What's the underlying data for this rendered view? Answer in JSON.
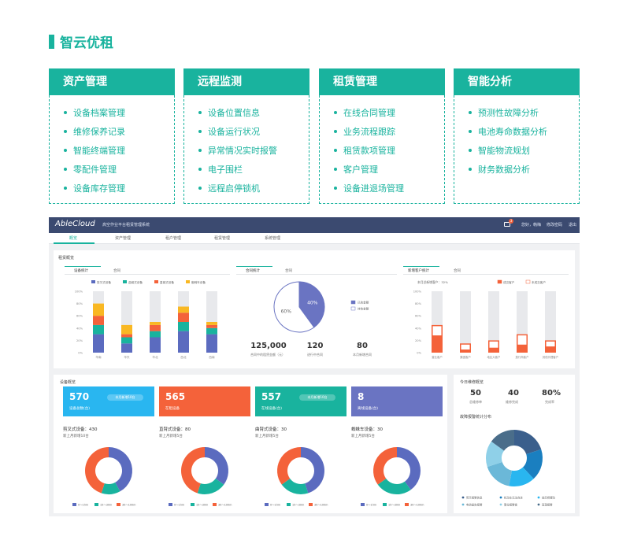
{
  "page_title": "智云优租",
  "cards": [
    {
      "title": "资产管理",
      "items": [
        "设备档案管理",
        "维修保养记录",
        "智能终端管理",
        "零配件管理",
        "设备库存管理"
      ]
    },
    {
      "title": "远程监测",
      "items": [
        "设备位置信息",
        "设备运行状况",
        "异常情况实时报警",
        "电子围栏",
        "远程启停锁机"
      ]
    },
    {
      "title": "租赁管理",
      "items": [
        "在线合同管理",
        "业务流程跟踪",
        "租赁款项管理",
        "客户管理",
        "设备进退场管理"
      ]
    },
    {
      "title": "智能分析",
      "items": [
        "预测性故障分析",
        "电池寿命数据分析",
        "智能物流规划",
        "财务数据分析"
      ]
    }
  ],
  "app": {
    "logo": "AbleCloud",
    "system_name": "高空作业平台租赁管理系统",
    "topbar_right": [
      "您好，韩梅",
      "修改密码",
      "退出"
    ],
    "msg_badge": "3",
    "nav": [
      "概览",
      "资产管理",
      "租户管理",
      "租赁管理",
      "系统管理"
    ],
    "lease_overview": {
      "title": "租赁概览",
      "device_stats": {
        "tabs": [
          "设备统计",
          "合同"
        ],
        "legend": [
          "剪叉式设备",
          "曲臂式设备",
          "直臂式设备",
          "蜘蛛车设备"
        ],
        "legend_colors": [
          "#5b6bbf",
          "#19b39e",
          "#f4623a",
          "#f9b823"
        ]
      },
      "contract_stats": {
        "tabs": [
          "合同统计",
          "合同"
        ],
        "legend": [
          "已收金额",
          "待收金额"
        ],
        "stats": [
          {
            "value": "125,000",
            "label": "合同中的租赁金额（元）"
          },
          {
            "value": "120",
            "label": "进行中合同"
          },
          {
            "value": "80",
            "label": "本月新增合同"
          }
        ]
      },
      "customer_stats": {
        "tabs": [
          "新增客户统计",
          "合同"
        ],
        "header": "本月总新增客户：32%",
        "legend": [
          "成交客户",
          "未成交客户"
        ]
      }
    },
    "device_overview": {
      "title": "设备概览",
      "boxes": [
        {
          "value": "570",
          "label": "设备总数(台)",
          "pill": "本月新增10台",
          "color": "#29b6f0"
        },
        {
          "value": "565",
          "label": "在租设备",
          "pill": "",
          "color": "#f4623a"
        },
        {
          "value": "557",
          "label": "在线设备(台)",
          "pill": "本月新增10台",
          "color": "#19b39e"
        },
        {
          "value": "8",
          "label": "离线设备(台)",
          "pill": "",
          "color": "#6a74c2"
        }
      ],
      "types": [
        {
          "title": "剪叉式设备：430",
          "sub": "新上月新增10台"
        },
        {
          "title": "直臂式设备：80",
          "sub": "新上月新增5台"
        },
        {
          "title": "曲臂式设备：30",
          "sub": "新上月新增5台"
        },
        {
          "title": "蜘蛛车设备：30",
          "sub": "新上月新增5台"
        }
      ],
      "donut_legend": [
        "0～15m",
        "15～30m",
        "30～100m"
      ],
      "donut_colors": [
        "#5b6bbf",
        "#19b39e",
        "#f4623a"
      ]
    },
    "today_repair": {
      "title": "今日维修概览",
      "stats": [
        {
          "value": "50",
          "label": "总维修单"
        },
        {
          "value": "40",
          "label": "维修完成"
        },
        {
          "value": "80%",
          "label": "完成率"
        }
      ],
      "fault_title": "故障报警统计分布",
      "fault_legend": [
        "剪叉报警信息",
        "机动车无法自走",
        "前后桥摆动",
        "电池量告报警",
        "限位报警锁",
        "高温报警"
      ]
    }
  },
  "chart_data": [
    {
      "type": "bar",
      "title": "设备统计",
      "categories": [
        "华南",
        "华东",
        "华北",
        "西北",
        "西南"
      ],
      "series": [
        {
          "name": "剪叉式设备",
          "values": [
            30,
            15,
            25,
            35,
            30
          ]
        },
        {
          "name": "曲臂式设备",
          "values": [
            15,
            10,
            10,
            15,
            10
          ]
        },
        {
          "name": "直臂式设备",
          "values": [
            15,
            5,
            10,
            15,
            5
          ]
        },
        {
          "name": "蜘蛛车设备",
          "values": [
            20,
            15,
            5,
            10,
            5
          ]
        }
      ],
      "ylim": [
        0,
        100
      ],
      "yticks": [
        "0%",
        "20%",
        "40%",
        "60%",
        "80%",
        "100%"
      ]
    },
    {
      "type": "pie",
      "title": "合同统计",
      "labels": [
        "已收金额",
        "待收金额"
      ],
      "values": [
        40,
        60
      ],
      "value_labels": [
        "40%",
        "60%"
      ],
      "colors": [
        "#6a74c2",
        "#ffffff"
      ]
    },
    {
      "type": "bar",
      "title": "新增客户统计",
      "categories": [
        "营业客户",
        "集团客户",
        "地区大客户",
        "旅行商客户",
        "其他代理客户"
      ],
      "series": [
        {
          "name": "成交客户",
          "values": [
            45,
            15,
            20,
            30,
            20
          ]
        },
        {
          "name": "未成交客户",
          "values": [
            15,
            8,
            10,
            15,
            8
          ]
        }
      ],
      "ylim": [
        0,
        100
      ],
      "yticks": [
        "0%",
        "20%",
        "40%",
        "60%",
        "80%",
        "100%"
      ]
    },
    {
      "type": "pie",
      "title": "剪叉式设备：430",
      "labels": [
        "0～15m",
        "15～30m",
        "30～100m"
      ],
      "values": [
        42,
        13,
        45
      ]
    },
    {
      "type": "pie",
      "title": "直臂式设备：80",
      "labels": [
        "0～15m",
        "15～30m",
        "30～100m"
      ],
      "values": [
        35,
        20,
        45
      ]
    },
    {
      "type": "pie",
      "title": "曲臂式设备：30",
      "labels": [
        "0～15m",
        "15～30m",
        "30～100m"
      ],
      "values": [
        45,
        20,
        35
      ]
    },
    {
      "type": "pie",
      "title": "蜘蛛车设备：30",
      "labels": [
        "0～15m",
        "15～30m",
        "30～100m"
      ],
      "values": [
        40,
        25,
        35
      ]
    },
    {
      "type": "pie",
      "title": "故障报警统计分布",
      "labels": [
        "剪叉报警信息",
        "机动车无法自走",
        "前后桥摆动",
        "电池量告报警",
        "限位报警锁",
        "高温报警"
      ],
      "values": [
        20,
        18,
        15,
        17,
        15,
        15
      ],
      "colors": [
        "#3b5f8c",
        "#1a7fc0",
        "#29b6f0",
        "#6bb8d8",
        "#8fd0e8",
        "#4a6d8a"
      ]
    }
  ]
}
